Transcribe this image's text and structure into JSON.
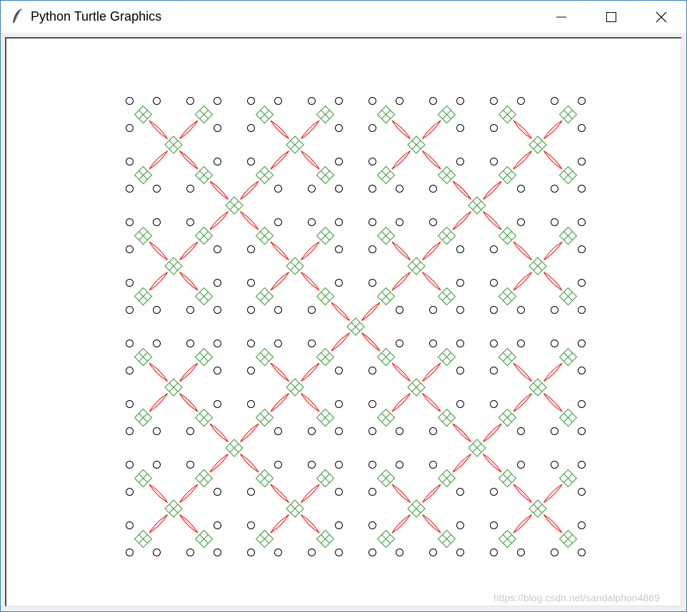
{
  "window": {
    "title": "Python Turtle Graphics",
    "icon": "feather-icon",
    "controls": {
      "minimize": "minimize-icon",
      "maximize": "maximize-icon",
      "close": "close-icon"
    }
  },
  "canvas": {
    "pattern": "fractal-cross",
    "colors": {
      "connector": "#ff0000",
      "node": "#2e9e2e",
      "loop": "#000000"
    }
  },
  "watermark": "https://blog.csdn.net/sandalphon4869"
}
